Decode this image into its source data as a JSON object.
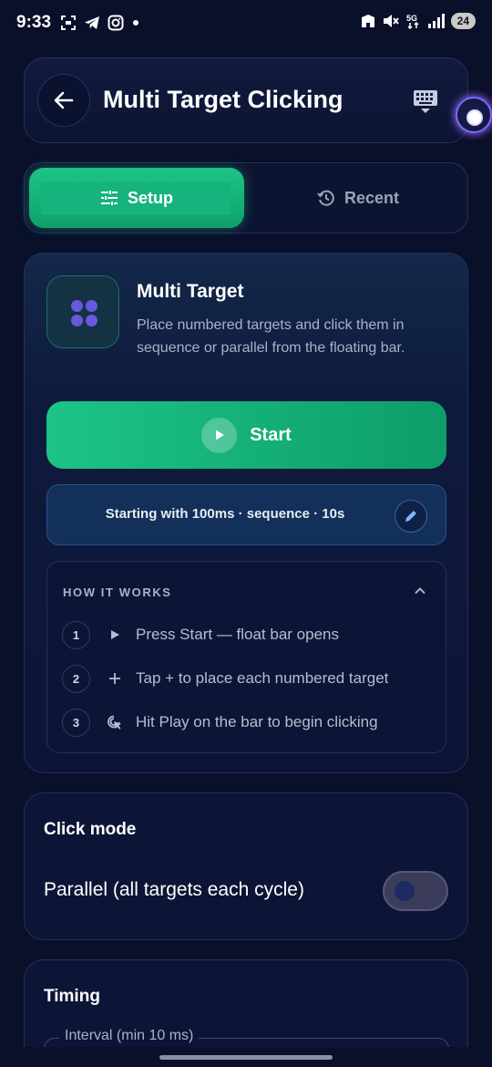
{
  "status_bar": {
    "time": "9:33",
    "battery": "24",
    "left_icons": [
      "screenshot-icon",
      "telegram-icon",
      "instagram-icon",
      "dot-icon"
    ],
    "right_icons": [
      "hotspot-icon",
      "mute-icon",
      "5g-icon",
      "signal-icon"
    ]
  },
  "header": {
    "title": "Multi Target Clicking",
    "back_icon": "arrow-left-icon",
    "keyboard_icon": "keyboard-icon"
  },
  "tabs": [
    {
      "label": "Setup",
      "icon": "sliders-icon",
      "active": true
    },
    {
      "label": "Recent",
      "icon": "history-icon",
      "active": false
    }
  ],
  "main": {
    "title": "Multi Target",
    "description": "Place numbered targets and click them in sequence or parallel from the floating bar.",
    "start_label": "Start",
    "summary": "Starting with 100ms · sequence · 10s",
    "how": {
      "heading": "HOW IT WORKS",
      "steps": [
        {
          "num": "1",
          "icon": "play-icon",
          "text": "Press Start — float bar opens"
        },
        {
          "num": "2",
          "icon": "plus-icon",
          "text": "Tap + to place each numbered target"
        },
        {
          "num": "3",
          "icon": "cursor-click-icon",
          "text": "Hit Play on the bar to begin clicking"
        }
      ]
    }
  },
  "click_mode": {
    "title": "Click mode",
    "option_label": "Parallel (all targets each cycle)",
    "enabled": false
  },
  "timing": {
    "title": "Timing",
    "interval_label": "Interval (min 10 ms)"
  },
  "colors": {
    "background": "#0a0f2a",
    "accent_green": "#1cc487",
    "card_border": "#23315c",
    "muted_text": "#a9b2c6"
  }
}
